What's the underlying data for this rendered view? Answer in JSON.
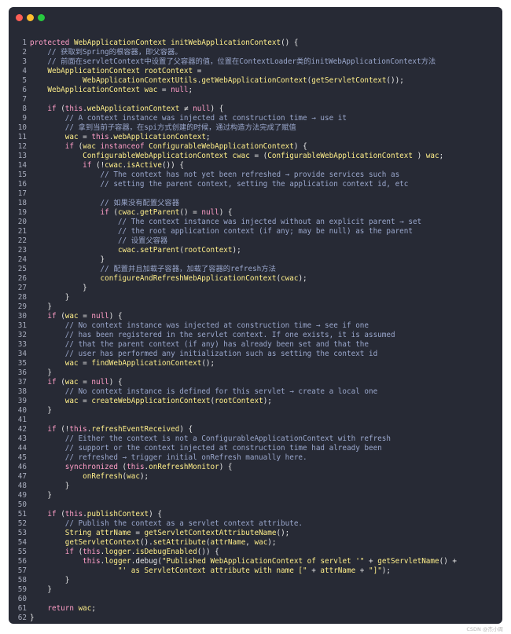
{
  "watermark": "CSDN @杰小周",
  "theme": {
    "keyword": "#ff9ec7",
    "identifier": "#ffef8a",
    "comment": "#9aa7cc",
    "plain": "#e8e8e8",
    "background": "#272a35"
  },
  "lines": [
    [
      [
        "kw",
        "protected "
      ],
      [
        "id",
        "WebApplicationContext initWebApplicationContext"
      ],
      [
        "",
        "() {"
      ]
    ],
    [
      [
        "cm",
        "    // 获取到Spring的根容器，即父容器。"
      ]
    ],
    [
      [
        "cm",
        "    // 前面在servletContext中设置了父容器的值，位置在ContextLoader类的initWebApplicationContext方法"
      ]
    ],
    [
      [
        "id",
        "    WebApplicationContext rootContext"
      ],
      [
        "",
        " ="
      ]
    ],
    [
      [
        "id",
        "            WebApplicationContextUtils"
      ],
      [
        "",
        "."
      ],
      [
        "id",
        "getWebApplicationContext"
      ],
      [
        "",
        "("
      ],
      [
        "id",
        "getServletContext"
      ],
      [
        "",
        "());"
      ]
    ],
    [
      [
        "id",
        "    WebApplicationContext wac"
      ],
      [
        "",
        " = "
      ],
      [
        "kw",
        "null"
      ],
      [
        "",
        ";"
      ]
    ],
    [
      [
        "",
        ""
      ]
    ],
    [
      [
        "kw",
        "    if "
      ],
      [
        "",
        "("
      ],
      [
        "kw",
        "this"
      ],
      [
        "",
        "."
      ],
      [
        "id",
        "webApplicationContext"
      ],
      [
        "",
        " ≠ "
      ],
      [
        "kw",
        "null"
      ],
      [
        "",
        ") {"
      ]
    ],
    [
      [
        "cm",
        "        // A context instance was injected at construction time → use it"
      ]
    ],
    [
      [
        "cm",
        "        // 拿到当前子容器，在spi方式创建的时候，通过构造方法完成了赋值"
      ]
    ],
    [
      [
        "id",
        "        wac"
      ],
      [
        "",
        " = "
      ],
      [
        "kw",
        "this"
      ],
      [
        "",
        "."
      ],
      [
        "id",
        "webApplicationContext"
      ],
      [
        "",
        ";"
      ]
    ],
    [
      [
        "kw",
        "        if "
      ],
      [
        "",
        "("
      ],
      [
        "id",
        "wac "
      ],
      [
        "kw",
        "instanceof "
      ],
      [
        "id",
        "ConfigurableWebApplicationContext"
      ],
      [
        "",
        ") {"
      ]
    ],
    [
      [
        "id",
        "            ConfigurableWebApplicationContext cwac"
      ],
      [
        "",
        " = ("
      ],
      [
        "id",
        "ConfigurableWebApplicationContext"
      ],
      [
        "",
        " ) "
      ],
      [
        "id",
        "wac"
      ],
      [
        "",
        ";"
      ]
    ],
    [
      [
        "kw",
        "            if "
      ],
      [
        "",
        "(!"
      ],
      [
        "id",
        "cwac"
      ],
      [
        "",
        "."
      ],
      [
        "id",
        "isActive"
      ],
      [
        "",
        "()) {"
      ]
    ],
    [
      [
        "cm",
        "                // The context has not yet been refreshed → provide services such as"
      ]
    ],
    [
      [
        "cm",
        "                // setting the parent context, setting the application context id, etc"
      ]
    ],
    [
      [
        "",
        ""
      ]
    ],
    [
      [
        "cm",
        "                // 如果没有配置父容器"
      ]
    ],
    [
      [
        "kw",
        "                if "
      ],
      [
        "",
        "("
      ],
      [
        "id",
        "cwac"
      ],
      [
        "",
        "."
      ],
      [
        "id",
        "getParent"
      ],
      [
        "",
        "() = "
      ],
      [
        "kw",
        "null"
      ],
      [
        "",
        ") {"
      ]
    ],
    [
      [
        "cm",
        "                    // The context instance was injected without an explicit parent → set"
      ]
    ],
    [
      [
        "cm",
        "                    // the root application context (if any; may be null) as the parent"
      ]
    ],
    [
      [
        "cm",
        "                    // 设置父容器"
      ]
    ],
    [
      [
        "id",
        "                    cwac"
      ],
      [
        "",
        "."
      ],
      [
        "id",
        "setParent"
      ],
      [
        "",
        "("
      ],
      [
        "id",
        "rootContext"
      ],
      [
        "",
        ");"
      ]
    ],
    [
      [
        "",
        "                }"
      ]
    ],
    [
      [
        "cm",
        "                // 配置并且加载子容器，加载了容器的refresh方法"
      ]
    ],
    [
      [
        "id",
        "                configureAndRefreshWebApplicationContext"
      ],
      [
        "",
        "("
      ],
      [
        "id",
        "cwac"
      ],
      [
        "",
        ");"
      ]
    ],
    [
      [
        "",
        "            }"
      ]
    ],
    [
      [
        "",
        "        }"
      ]
    ],
    [
      [
        "",
        "    }"
      ]
    ],
    [
      [
        "kw",
        "    if "
      ],
      [
        "",
        "("
      ],
      [
        "id",
        "wac"
      ],
      [
        "",
        " = "
      ],
      [
        "kw",
        "null"
      ],
      [
        "",
        ") {"
      ]
    ],
    [
      [
        "cm",
        "        // No context instance was injected at construction time → see if one"
      ]
    ],
    [
      [
        "cm",
        "        // has been registered in the servlet context. If one exists, it is assumed"
      ]
    ],
    [
      [
        "cm",
        "        // that the parent context (if any) has already been set and that the"
      ]
    ],
    [
      [
        "cm",
        "        // user has performed any initialization such as setting the context id"
      ]
    ],
    [
      [
        "id",
        "        wac"
      ],
      [
        "",
        " = "
      ],
      [
        "id",
        "findWebApplicationContext"
      ],
      [
        "",
        "();"
      ]
    ],
    [
      [
        "",
        "    }"
      ]
    ],
    [
      [
        "kw",
        "    if "
      ],
      [
        "",
        "("
      ],
      [
        "id",
        "wac"
      ],
      [
        "",
        " = "
      ],
      [
        "kw",
        "null"
      ],
      [
        "",
        ") {"
      ]
    ],
    [
      [
        "cm",
        "        // No context instance is defined for this servlet → create a local one"
      ]
    ],
    [
      [
        "id",
        "        wac"
      ],
      [
        "",
        " = "
      ],
      [
        "id",
        "createWebApplicationContext"
      ],
      [
        "",
        "("
      ],
      [
        "id",
        "rootContext"
      ],
      [
        "",
        ");"
      ]
    ],
    [
      [
        "",
        "    }"
      ]
    ],
    [
      [
        "",
        ""
      ]
    ],
    [
      [
        "kw",
        "    if "
      ],
      [
        "",
        "(!"
      ],
      [
        "kw",
        "this"
      ],
      [
        "",
        "."
      ],
      [
        "id",
        "refreshEventReceived"
      ],
      [
        "",
        ") {"
      ]
    ],
    [
      [
        "cm",
        "        // Either the context is not a ConfigurableApplicationContext with refresh"
      ]
    ],
    [
      [
        "cm",
        "        // support or the context injected at construction time had already been"
      ]
    ],
    [
      [
        "cm",
        "        // refreshed → trigger initial onRefresh manually here."
      ]
    ],
    [
      [
        "kw",
        "        synchronized "
      ],
      [
        "",
        "("
      ],
      [
        "kw",
        "this"
      ],
      [
        "",
        "."
      ],
      [
        "id",
        "onRefreshMonitor"
      ],
      [
        "",
        ") {"
      ]
    ],
    [
      [
        "id",
        "            onRefresh"
      ],
      [
        "",
        "("
      ],
      [
        "id",
        "wac"
      ],
      [
        "",
        ");"
      ]
    ],
    [
      [
        "",
        "        }"
      ]
    ],
    [
      [
        "",
        "    }"
      ]
    ],
    [
      [
        "",
        ""
      ]
    ],
    [
      [
        "kw",
        "    if "
      ],
      [
        "",
        "("
      ],
      [
        "kw",
        "this"
      ],
      [
        "",
        "."
      ],
      [
        "id",
        "publishContext"
      ],
      [
        "",
        ") {"
      ]
    ],
    [
      [
        "cm",
        "        // Publish the context as a servlet context attribute."
      ]
    ],
    [
      [
        "id",
        "        String attrName"
      ],
      [
        "",
        " = "
      ],
      [
        "id",
        "getServletContextAttributeName"
      ],
      [
        "",
        "();"
      ]
    ],
    [
      [
        "id",
        "        getServletContext"
      ],
      [
        "",
        "()."
      ],
      [
        "id",
        "setAttribute"
      ],
      [
        "",
        "("
      ],
      [
        "id",
        "attrName"
      ],
      [
        "",
        ", "
      ],
      [
        "id",
        "wac"
      ],
      [
        "",
        ");"
      ]
    ],
    [
      [
        "kw",
        "        if "
      ],
      [
        "",
        "("
      ],
      [
        "kw",
        "this"
      ],
      [
        "",
        "."
      ],
      [
        "id",
        "logger"
      ],
      [
        "",
        "."
      ],
      [
        "id",
        "isDebugEnabled"
      ],
      [
        "",
        "()) {"
      ]
    ],
    [
      [
        "kw",
        "            this"
      ],
      [
        "",
        "."
      ],
      [
        "id",
        "logger"
      ],
      [
        "",
        ".debug("
      ],
      [
        "str",
        "\"Published WebApplicationContext of servlet '\""
      ],
      [
        "",
        " + "
      ],
      [
        "id",
        "getServletName"
      ],
      [
        "",
        "() +"
      ]
    ],
    [
      [
        "str",
        "                    \"' as ServletContext attribute with name [\""
      ],
      [
        "",
        " + "
      ],
      [
        "id",
        "attrName"
      ],
      [
        "",
        " + "
      ],
      [
        "str",
        "\"]\""
      ],
      [
        "",
        ");"
      ]
    ],
    [
      [
        "",
        "        }"
      ]
    ],
    [
      [
        "",
        "    }"
      ]
    ],
    [
      [
        "",
        ""
      ]
    ],
    [
      [
        "kw",
        "    return "
      ],
      [
        "id",
        "wac"
      ],
      [
        "",
        ";"
      ]
    ],
    [
      [
        "",
        "}"
      ]
    ]
  ]
}
